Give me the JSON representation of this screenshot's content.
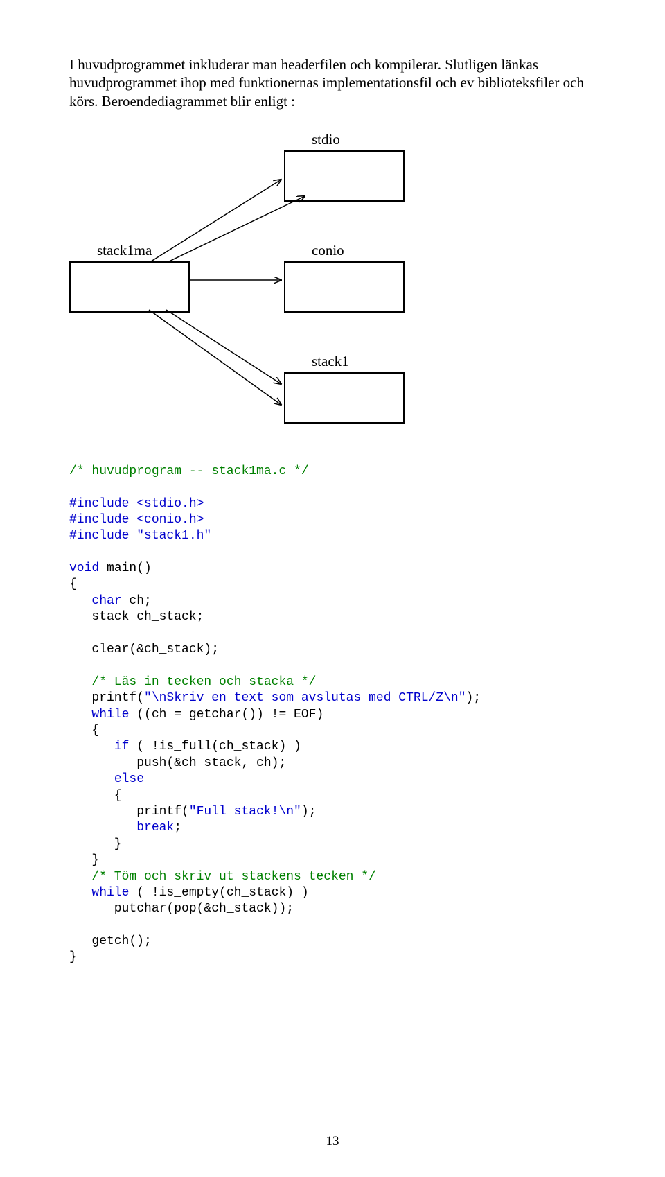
{
  "intro": "I huvudprogrammet inkluderar man headerfilen och kompilerar. Slutligen länkas huvudprogrammet ihop med funktionernas implementationsfil och ev biblioteksfiler och körs. Beroendediagrammet blir enligt :",
  "labels": {
    "stdio": "stdio",
    "stack1ma": "stack1ma",
    "conio": "conio",
    "stack1": "stack1"
  },
  "code": {
    "c01": "/* huvudprogram -- stack1ma.c */",
    "c02": "#include <stdio.h>",
    "c03": "#include <conio.h>",
    "c04": "#include \"stack1.h\"",
    "c05": "void",
    "c05b": " main()",
    "c06": "{",
    "c07": "   ",
    "c07k": "char",
    "c07b": " ch;",
    "c08": "   stack ch_stack;",
    "c09": "   clear(&ch_stack);",
    "c10": "   ",
    "c10c": "/* Läs in tecken och stacka */",
    "c11": "   printf(",
    "c11s": "\"\\nSkriv en text som avslutas med CTRL/Z\\n\"",
    "c11e": ");",
    "c12": "   ",
    "c12k": "while",
    "c12b": " ((ch = getchar()) != EOF)",
    "c13": "   {",
    "c14": "      ",
    "c14k": "if",
    "c14b": " ( !is_full(ch_stack) )",
    "c15": "         push(&ch_stack, ch);",
    "c16": "      ",
    "c16k": "else",
    "c17": "      {",
    "c18": "         printf(",
    "c18s": "\"Full stack!\\n\"",
    "c18e": ");",
    "c19": "         ",
    "c19k": "break",
    "c19e": ";",
    "c20": "      }",
    "c21": "   }",
    "c22": "   ",
    "c22c": "/* Töm och skriv ut stackens tecken */",
    "c23": "   ",
    "c23k": "while",
    "c23b": " ( !is_empty(ch_stack) )",
    "c24": "      putchar(pop(&ch_stack));",
    "c25": "   getch();",
    "c26": "}"
  },
  "pagenum": "13"
}
